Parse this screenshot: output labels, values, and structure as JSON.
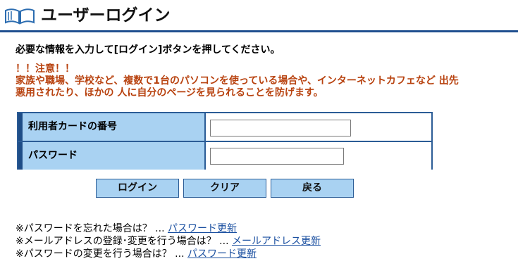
{
  "header": {
    "title": "ユーザーログイン",
    "icon": "open-book-icon"
  },
  "instruction": "必要な情報を入力して[ログイン]ボタンを押してください。",
  "warning": {
    "heading": "！！注意！！",
    "line1": "家族や職場、学校など、複数で1台のパソコンを使っている場合や、インターネットカフェなど 出先",
    "line2": "悪用されたり、ほかの 人に自分のページを見られることを防げます。"
  },
  "form": {
    "card_label": "利用者カードの番号",
    "card_value": "",
    "password_label": "パスワード",
    "password_value": ""
  },
  "buttons": {
    "login": "ログイン",
    "clear": "クリア",
    "back": "戻る"
  },
  "help": [
    {
      "text": "※パスワードを忘れた場合は？ ... ",
      "link": "パスワード更新"
    },
    {
      "text": "※メールアドレスの登録･変更を行う場合は？ ... ",
      "link": "メールアドレス更新"
    },
    {
      "text": "※パスワードの変更を行う場合は？ ... ",
      "link": "パスワード更新"
    }
  ],
  "colors": {
    "accent": "#1f4f8f",
    "label_bg": "#a9d2f2",
    "warning": "#b8420f",
    "link": "#1a4fa0"
  }
}
